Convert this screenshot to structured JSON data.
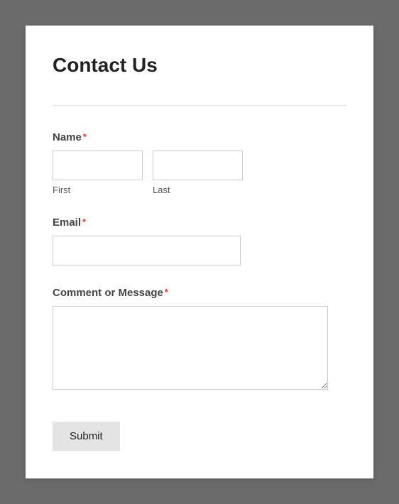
{
  "form": {
    "title": "Contact Us",
    "fields": {
      "name": {
        "label": "Name",
        "required": "*",
        "first": {
          "value": "",
          "sublabel": "First"
        },
        "last": {
          "value": "",
          "sublabel": "Last"
        }
      },
      "email": {
        "label": "Email",
        "required": "*",
        "value": ""
      },
      "message": {
        "label": "Comment or Message",
        "required": "*",
        "value": ""
      }
    },
    "submit_label": "Submit"
  }
}
